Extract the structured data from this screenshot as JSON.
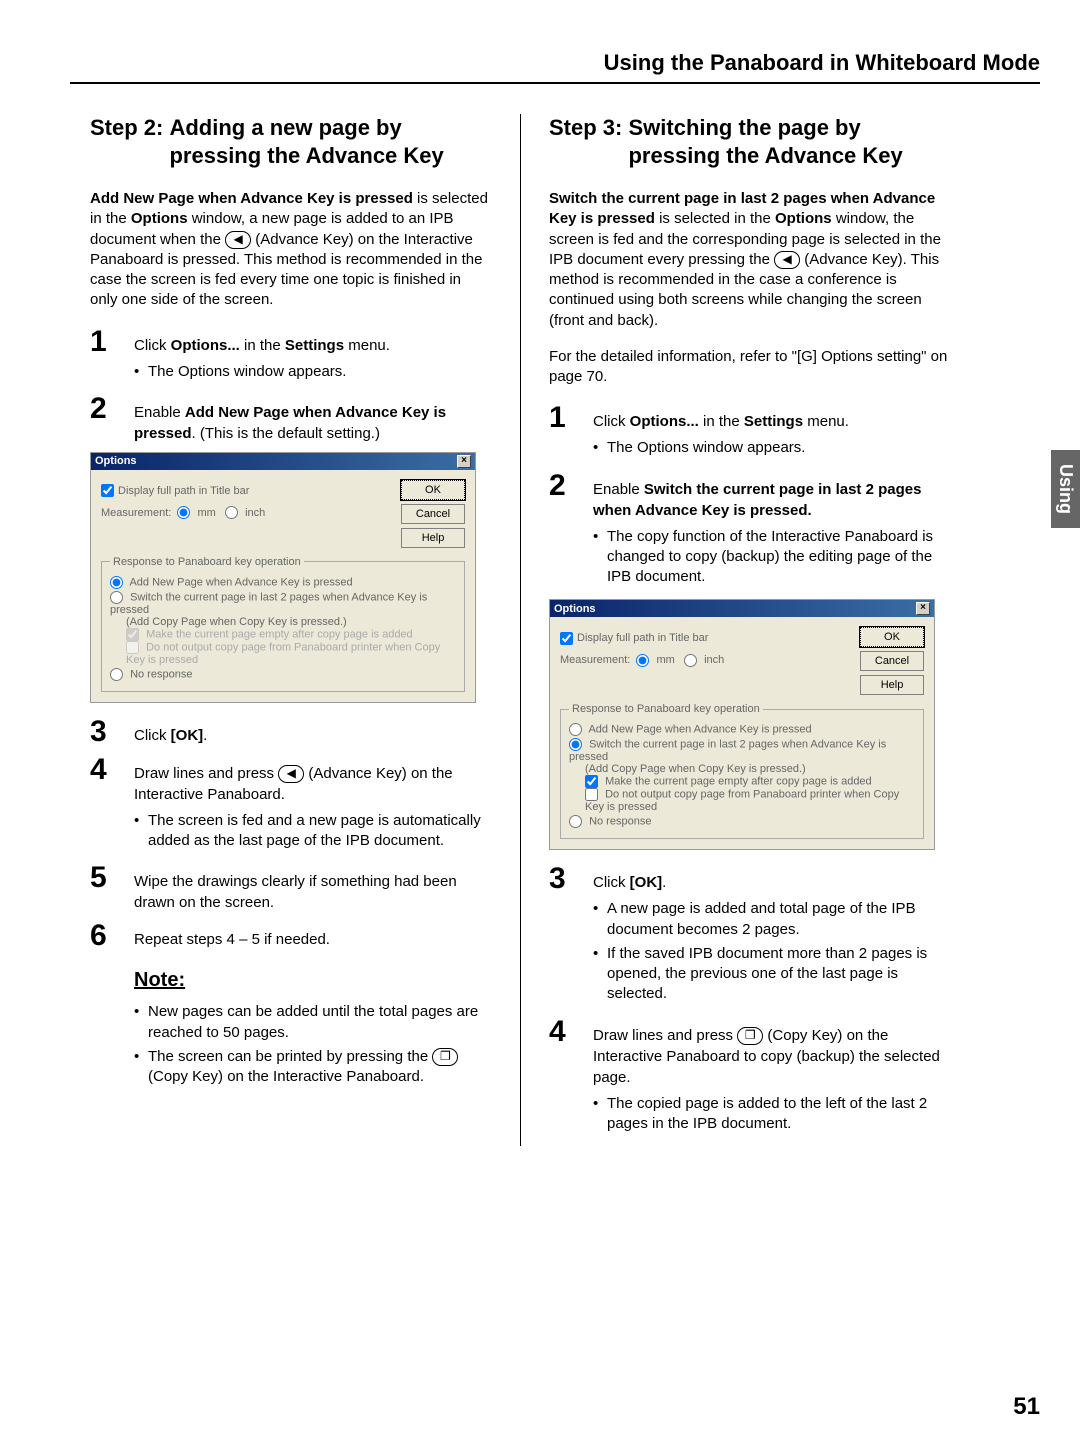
{
  "header": "Using the Panaboard in Whiteboard Mode",
  "side_tab": "Using",
  "page_number": "51",
  "icons": {
    "advance": "◀",
    "copy": "❐"
  },
  "dialog_common": {
    "title": "Options",
    "display_full": "Display full path in Title bar",
    "measurement_label": "Measurement:",
    "mm": "mm",
    "inch": "inch",
    "ok": "OK",
    "cancel": "Cancel",
    "help": "Help",
    "group_label": "Response to Panaboard key operation",
    "opt_add": "Add New Page when Advance Key is pressed",
    "opt_switch": "Switch the current page in last 2 pages when Advance Key is pressed",
    "opt_switch_sub": "(Add Copy Page when Copy Key is pressed.)",
    "chk_make_empty": "Make the current page empty after copy page is added",
    "chk_no_output": "Do not output copy page from Panaboard printer when Copy Key is pressed",
    "opt_none": "No response"
  },
  "left": {
    "step_label": "Step 2:",
    "step_title": "Adding a new page by pressing the Advance Key",
    "intro_a": "Add New Page when Advance Key is pressed",
    "intro_b": " is selected in the ",
    "intro_c": "Options",
    "intro_d": " window, a new page is added to an IPB document when the ",
    "intro_e": " (Advance Key) on the Interactive Panaboard is pressed. This method is recommended in the case the screen is fed every time one topic is finished in only one side of the screen.",
    "s1_a": "Click ",
    "s1_b": "Options...",
    "s1_c": " in the ",
    "s1_d": "Settings",
    "s1_e": " menu.",
    "s1_bullet": "The Options window appears.",
    "s2_a": "Enable ",
    "s2_b": "Add New Page when Advance Key is pressed",
    "s2_c": ". (This is the default setting.)",
    "s3_a": "Click ",
    "s3_b": "[OK]",
    "s3_c": ".",
    "s4_a": "Draw lines and press ",
    "s4_b": " (Advance Key) on the Interactive Panaboard.",
    "s4_bullet": "The screen is fed and a new page is automatically added as the last page of the IPB document.",
    "s5": "Wipe the drawings clearly if something had been drawn on the screen.",
    "s6": "Repeat steps 4 – 5 if needed.",
    "note_heading": "Note:",
    "note1": "New pages can be added until the total pages are reached to 50 pages.",
    "note2_a": "The screen can be printed by pressing the ",
    "note2_b": " (Copy Key) on the Interactive Panaboard."
  },
  "right": {
    "step_label": "Step 3:",
    "step_title": "Switching the page by pressing the Advance Key",
    "intro_a": "Switch the current page in last 2 pages when Advance Key is pressed",
    "intro_b": " is selected in the ",
    "intro_c": "Options",
    "intro_d": " window, the screen is fed and the corresponding page is selected in the IPB document every pressing the ",
    "intro_e": " (Advance Key). This method is recommended in the case a conference is continued using both screens while changing the screen (front and back).",
    "ref": "For the detailed information, refer to \"[G] Options setting\" on page 70.",
    "s1_a": "Click ",
    "s1_b": "Options...",
    "s1_c": " in the ",
    "s1_d": "Settings",
    "s1_e": " menu.",
    "s1_bullet": "The Options window appears.",
    "s2_a": "Enable ",
    "s2_b": "Switch the current page in last 2 pages when Advance Key is pressed.",
    "s2_bullet": "The copy function of the Interactive Panaboard is changed to copy (backup) the editing page of the IPB document.",
    "s3_a": "Click ",
    "s3_b": "[OK]",
    "s3_c": ".",
    "s3_bullet1": "A new page is added and total page of the IPB document becomes 2 pages.",
    "s3_bullet2": "If the saved IPB document more than 2 pages is opened, the previous one of the last page is selected.",
    "s4_a": "Draw lines and press ",
    "s4_b": " (Copy Key) on the Interactive Panaboard to copy (backup) the selected page.",
    "s4_bullet": "The copied page is added to the left of the last 2 pages in the IPB document."
  }
}
